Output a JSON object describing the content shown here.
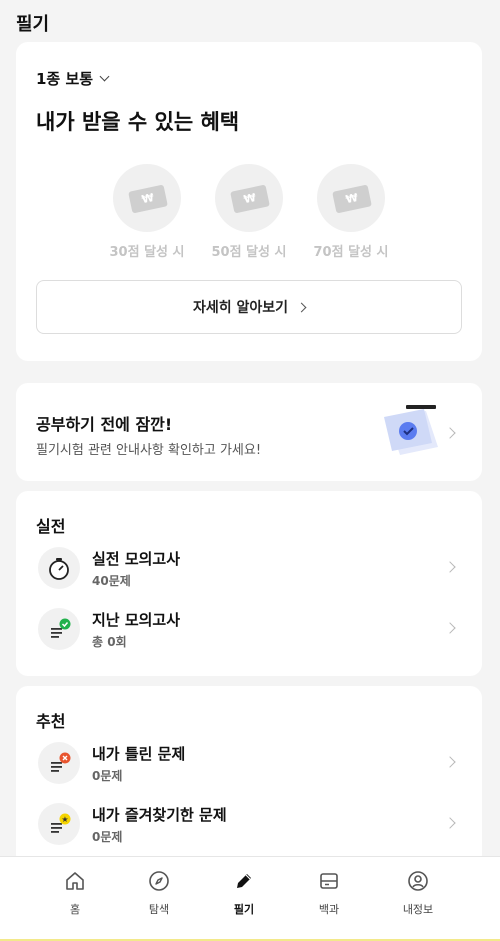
{
  "header": {
    "title": "필기"
  },
  "benefit": {
    "license_select": "1종 보통",
    "title": "내가 받을 수 있는 혜택",
    "rewards": [
      {
        "label": "30점 달성 시",
        "symbol": "₩"
      },
      {
        "label": "50점 달성 시",
        "symbol": "₩"
      },
      {
        "label": "70점 달성 시",
        "symbol": "₩"
      }
    ],
    "more_button": "자세히 알아보기"
  },
  "notice": {
    "title": "공부하기 전에 잠깐!",
    "subtitle": "필기시험 관련 안내사항 확인하고 가세요!"
  },
  "practice": {
    "title": "실전",
    "items": [
      {
        "title": "실전 모의고사",
        "sub": "40문제",
        "icon": "stopwatch-icon"
      },
      {
        "title": "지난 모의고사",
        "sub": "총 0회",
        "icon": "document-check-icon"
      }
    ]
  },
  "recommend": {
    "title": "추천",
    "items": [
      {
        "title": "내가 틀린 문제",
        "sub": "0문제",
        "icon": "document-wrong-icon"
      },
      {
        "title": "내가 즐겨찾기한 문제",
        "sub": "0문제",
        "icon": "document-star-icon"
      }
    ]
  },
  "nav": {
    "items": [
      {
        "label": "홈",
        "icon": "home-icon"
      },
      {
        "label": "탐색",
        "icon": "compass-icon"
      },
      {
        "label": "필기",
        "icon": "pencil-icon",
        "active": true
      },
      {
        "label": "백과",
        "icon": "book-icon"
      },
      {
        "label": "내정보",
        "icon": "profile-icon"
      }
    ]
  },
  "colors": {
    "background": "#f4f4f4",
    "accent_blue": "#5b7cf0",
    "check_green": "#22b14c",
    "wrong_red": "#e8552f",
    "star_yellow": "#f5d400"
  }
}
